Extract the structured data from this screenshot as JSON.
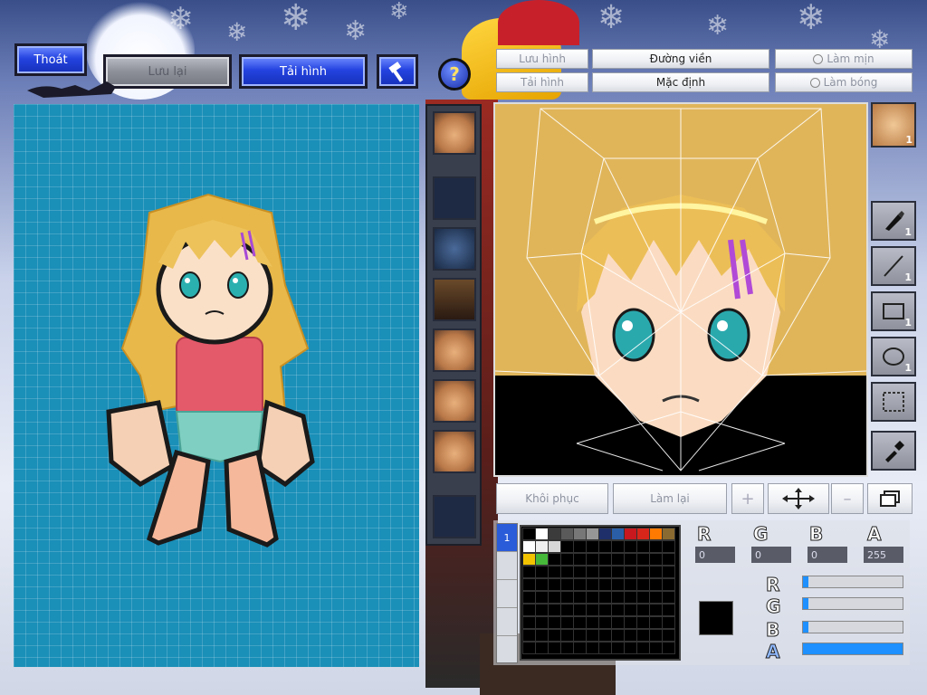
{
  "top_buttons": {
    "exit": "Thoát",
    "save": "Lưu lại",
    "reload": "Tải hình"
  },
  "editor_buttons": {
    "save_image": "Lưu hình",
    "reload_image": "Tải hình",
    "outline": "Đường viền",
    "default": "Mặc định",
    "smooth": "Làm mịn",
    "shine": "Làm bóng",
    "restore": "Khôi phục",
    "redo": "Làm lại"
  },
  "part_thumbnails": [
    "head",
    "empty",
    "hair",
    "body",
    "goggles",
    "face",
    "face-alt",
    "empty"
  ],
  "tools": [
    {
      "icon": "brush-icon",
      "count": "1"
    },
    {
      "icon": "line-icon",
      "count": "1"
    },
    {
      "icon": "rectangle-icon",
      "count": "1"
    },
    {
      "icon": "ellipse-icon",
      "count": "1"
    },
    {
      "icon": "selection-icon",
      "count": ""
    },
    {
      "icon": "eyedropper-icon",
      "count": ""
    }
  ],
  "head_thumb_count": "1",
  "color": {
    "r_label": "R",
    "g_label": "G",
    "b_label": "B",
    "a_label": "A",
    "r": "0",
    "g": "0",
    "b": "0",
    "a": "255",
    "current": "#000000",
    "slider_levels": {
      "r": 0,
      "g": 0,
      "b": 0,
      "a": 1
    }
  },
  "palette": [
    [
      "#000000",
      "#ffffff",
      "#3b3b3b",
      "#5a5a5a",
      "#777777",
      "#969696",
      "#1f2f6a",
      "#2a5fa8",
      "#c9181e",
      "#d8261a",
      "#ff7a00",
      "#8a6a30"
    ],
    [
      "#ffffff",
      "#f0f0f0",
      "#d8d8d8",
      "#000000",
      "#000000",
      "#000000",
      "#000000",
      "#000000",
      "#000000",
      "#000000",
      "#000000",
      "#000000"
    ],
    [
      "#f2c300",
      "#46b83a",
      "#000000",
      "#000000",
      "#000000",
      "#000000",
      "#000000",
      "#000000",
      "#000000",
      "#000000",
      "#000000",
      "#000000"
    ]
  ],
  "palette_tab_label": "1"
}
